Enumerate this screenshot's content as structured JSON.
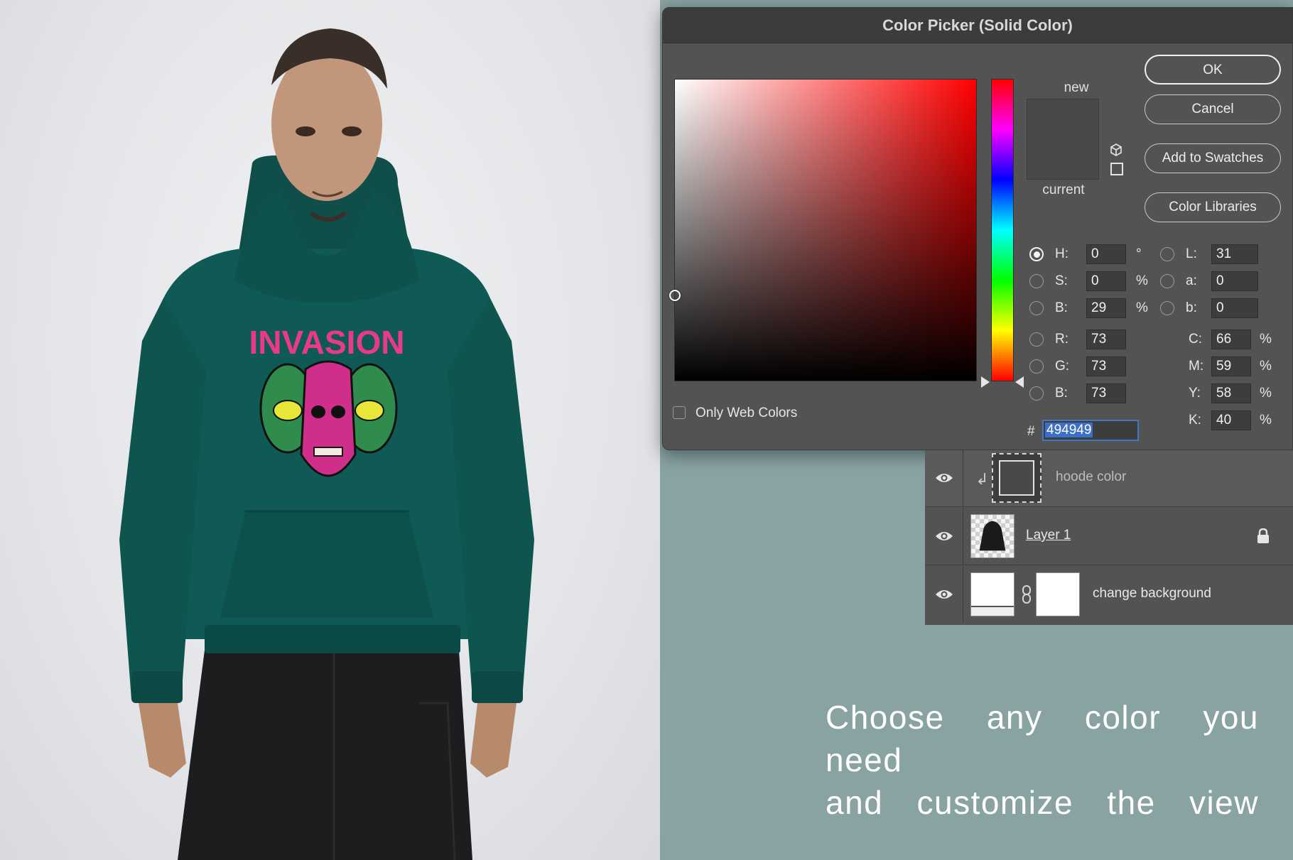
{
  "dialog": {
    "title": "Color Picker (Solid Color)",
    "new_label": "new",
    "current_label": "current",
    "buttons": {
      "ok": "OK",
      "cancel": "Cancel",
      "add_swatches": "Add to Swatches",
      "color_libraries": "Color Libraries"
    },
    "only_web_colors": "Only Web Colors",
    "hex_symbol": "#",
    "hex_value": "494949",
    "fields": {
      "hsb": [
        {
          "label": "H:",
          "value": "0",
          "unit": "°"
        },
        {
          "label": "S:",
          "value": "0",
          "unit": "%"
        },
        {
          "label": "B:",
          "value": "29",
          "unit": "%"
        }
      ],
      "rgb": [
        {
          "label": "R:",
          "value": "73"
        },
        {
          "label": "G:",
          "value": "73"
        },
        {
          "label": "B:",
          "value": "73"
        }
      ],
      "lab": [
        {
          "label": "L:",
          "value": "31"
        },
        {
          "label": "a:",
          "value": "0"
        },
        {
          "label": "b:",
          "value": "0"
        }
      ],
      "cmyk": [
        {
          "label": "C:",
          "value": "66",
          "unit": "%"
        },
        {
          "label": "M:",
          "value": "59",
          "unit": "%"
        },
        {
          "label": "Y:",
          "value": "58",
          "unit": "%"
        },
        {
          "label": "K:",
          "value": "40",
          "unit": "%"
        }
      ]
    },
    "selected_color": "#494949"
  },
  "layers": [
    {
      "name": "hoode color"
    },
    {
      "name": "Layer 1"
    },
    {
      "name": "change background"
    }
  ],
  "caption": {
    "line1": "Choose any color you need",
    "line2": "and customize the view"
  },
  "photo": {
    "print_text": "INVASION",
    "hoodie_color": "#0f5a55",
    "background_color": "#89a3a3"
  }
}
